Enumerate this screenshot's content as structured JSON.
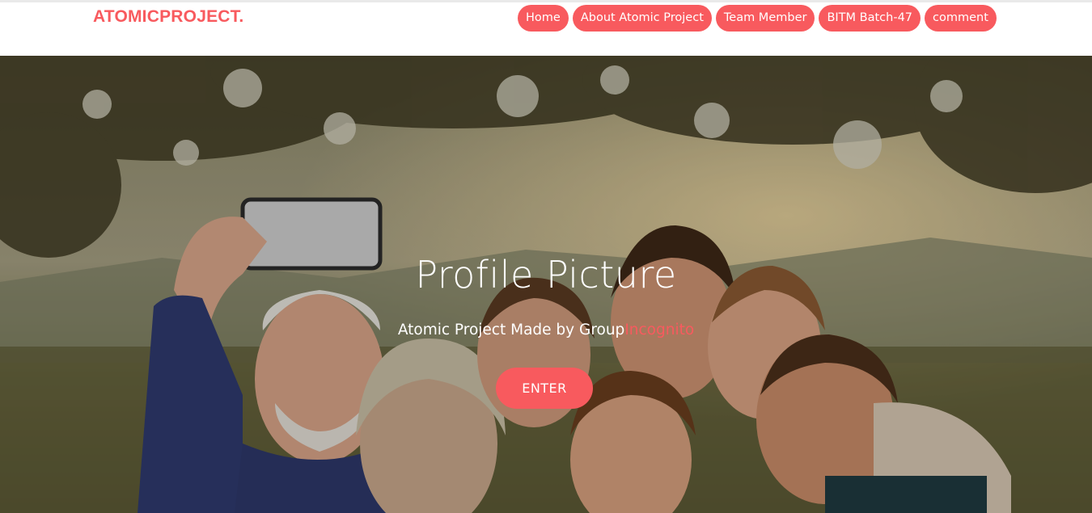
{
  "header": {
    "brand": "ATOMICPROJECT.",
    "nav": [
      {
        "label": "Home"
      },
      {
        "label": "About Atomic Project"
      },
      {
        "label": "Team Member"
      },
      {
        "label": "BITM Batch-47"
      },
      {
        "label": "comment"
      }
    ]
  },
  "hero": {
    "title": "Profile Picture",
    "subtitle_prefix": "Atomic Project Made by Group",
    "subtitle_accent": "Incognito",
    "enter_label": "ENTER",
    "image_icon": "group-selfie-photo"
  },
  "colors": {
    "accent": "#f85a5e",
    "header_bg": "#ffffff",
    "hero_text": "#ffffff"
  }
}
